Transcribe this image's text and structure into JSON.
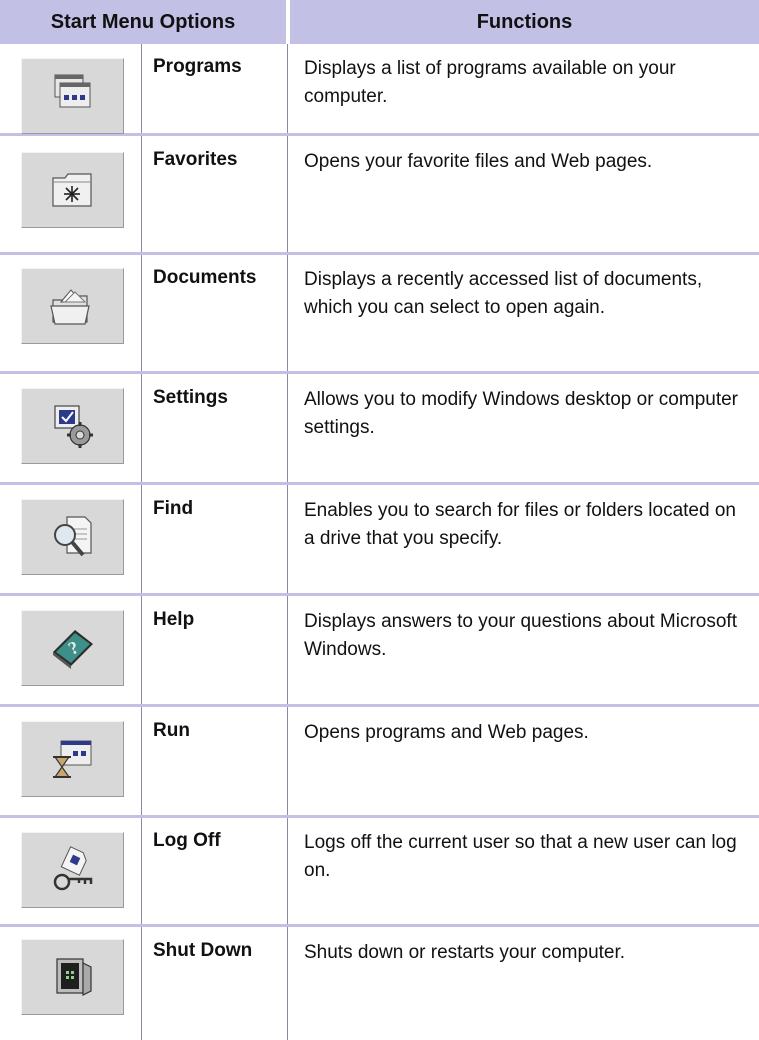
{
  "header": {
    "col1": "Start Menu Options",
    "col2": "Functions"
  },
  "rows": [
    {
      "icon": "programs-icon",
      "option": "Programs",
      "function": "Displays a list of programs available on your computer."
    },
    {
      "icon": "favorites-icon",
      "option": "Favorites",
      "function": "Opens your favorite files and Web pages."
    },
    {
      "icon": "documents-icon",
      "option": "Documents",
      "function": "Displays a recently accessed list of documents, which you can select to open again."
    },
    {
      "icon": "settings-icon",
      "option": "Settings",
      "function": "Allows you to modify Windows desktop or computer settings."
    },
    {
      "icon": "find-icon",
      "option": "Find",
      "function": "Enables you to search for files or folders located on a drive that you specify."
    },
    {
      "icon": "help-icon",
      "option": "Help",
      "function": "Displays answers to your questions about Microsoft Windows."
    },
    {
      "icon": "run-icon",
      "option": "Run",
      "function": "Opens programs and Web pages."
    },
    {
      "icon": "log-off-icon",
      "option": "Log Off",
      "function": "Logs off the current user so that a new user can log on."
    },
    {
      "icon": "shut-down-icon",
      "option": "Shut Down",
      "function": "Shuts down or restarts your computer."
    }
  ],
  "colors": {
    "header_bg": "#c2c0e5",
    "separator": "#c2c0e5",
    "icon_bg": "#d8d8d8"
  }
}
